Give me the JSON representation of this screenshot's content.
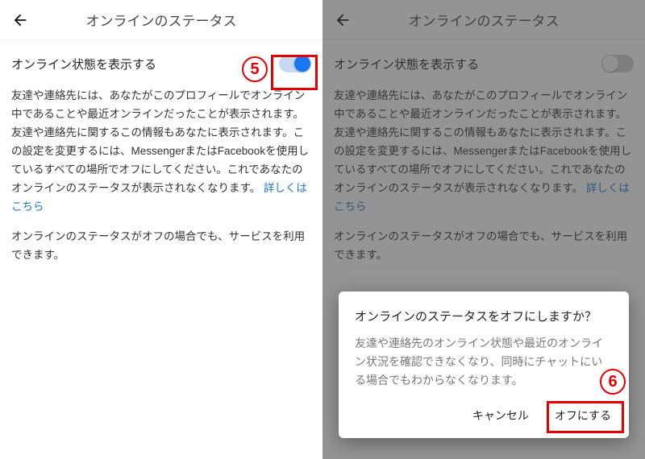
{
  "left": {
    "header": {
      "title": "オンラインのステータス"
    },
    "toggle_label": "オンライン状態を表示する",
    "toggle_state": "on",
    "description": "友達や連絡先には、あなたがこのプロフィールでオンライン中であることや最近オンラインだったことが表示されます。友達や連絡先に関するこの情報もあなたに表示されます。この設定を変更するには、MessengerまたはFacebookを使用しているすべての場所でオフにしてください。これであなたのオンラインのステータスが表示されなくなります。",
    "link_text": "詳しくはこちら",
    "description2": "オンラインのステータスがオフの場合でも、サービスを利用できます。",
    "callout": "5"
  },
  "right": {
    "header": {
      "title": "オンラインのステータス"
    },
    "toggle_label": "オンライン状態を表示する",
    "toggle_state": "off",
    "description": "友達や連絡先には、あなたがこのプロフィールでオンライン中であることや最近オンラインだったことが表示されます。友達や連絡先に関するこの情報もあなたに表示されます。この設定を変更するには、MessengerまたはFacebookを使用しているすべての場所でオフにしてください。これであなたのオンラインのステータスが表示されなくなります。",
    "link_text": "詳しくはこちら",
    "description2": "オンラインのステータスがオフの場合でも、サービスを利用できます。",
    "dialog": {
      "title": "オンラインのステータスをオフにしますか？",
      "body": "友達や連絡先のオンライン状態や最近のオンライン状況を確認できなくなり、同時にチャットにいる場合でもわからなくなります。",
      "cancel": "キャンセル",
      "confirm": "オフにする"
    },
    "callout": "6"
  }
}
